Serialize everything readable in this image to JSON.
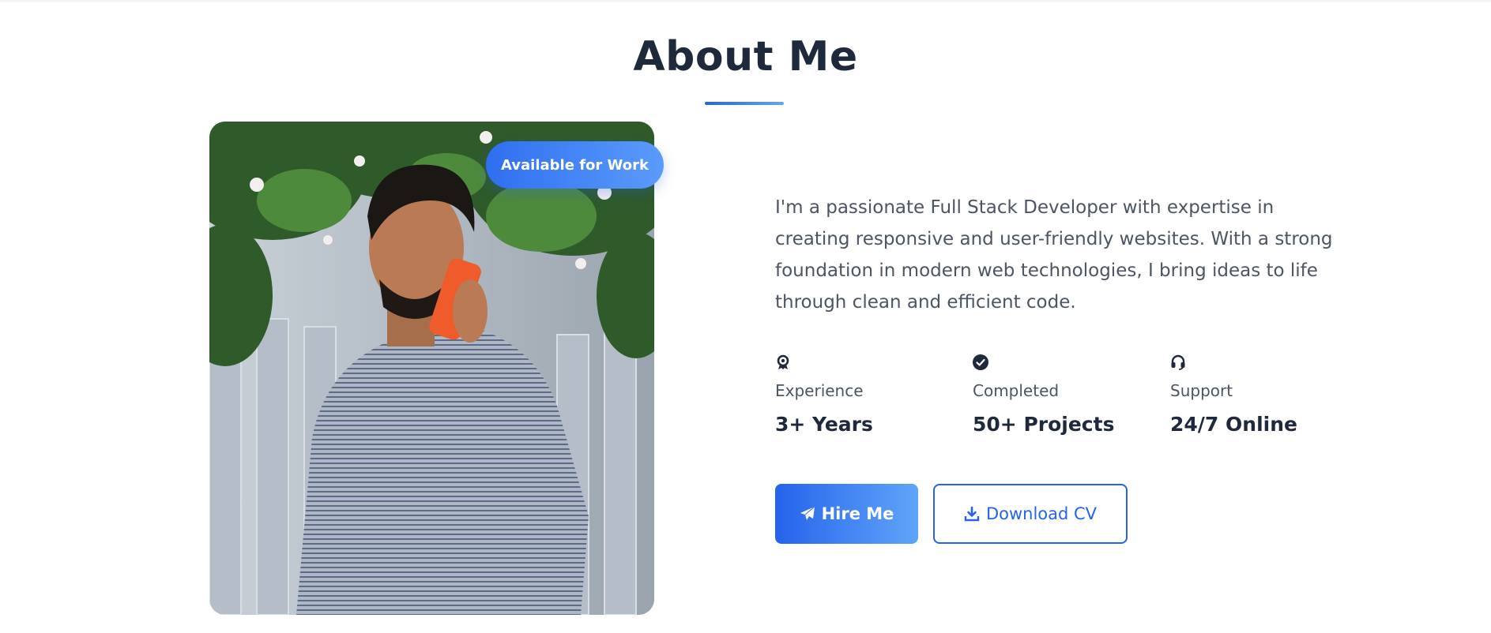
{
  "about": {
    "title": "About Me",
    "badge": "Available for Work",
    "intro": "I'm a passionate Full Stack Developer with expertise in creating responsive and user-friendly websites. With a strong foundation in modern web technologies, I bring ideas to life through clean and efficient code.",
    "stats": [
      {
        "icon": "award-icon",
        "label": "Experience",
        "value": "3+ Years"
      },
      {
        "icon": "check-circle-icon",
        "label": "Completed",
        "value": "50+ Projects"
      },
      {
        "icon": "headset-icon",
        "label": "Support",
        "value": "24/7 Online"
      }
    ],
    "buttons": {
      "hire": {
        "icon": "paper-plane-icon",
        "label": "Hire Me"
      },
      "cv": {
        "icon": "download-icon",
        "label": "Download CV"
      }
    },
    "photo": {
      "description_icon": "profile-photo"
    }
  },
  "colors": {
    "accent": "#2563eb",
    "accent_light": "#60a5fa",
    "heading": "#1e293b",
    "body_text": "#4b5563"
  }
}
